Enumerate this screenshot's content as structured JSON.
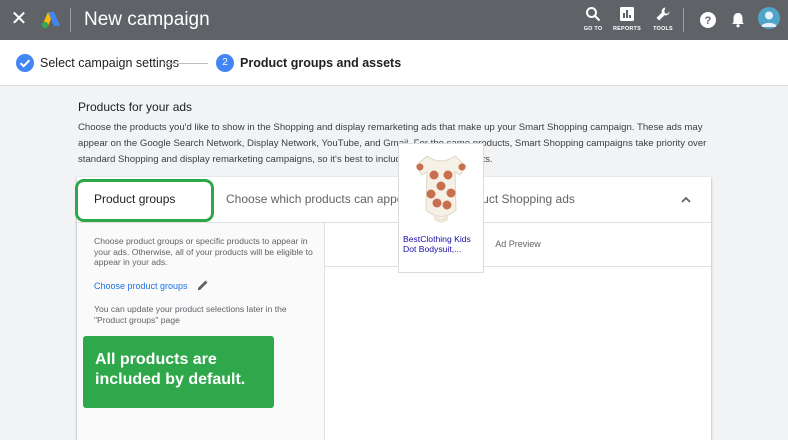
{
  "topbar": {
    "title": "New campaign",
    "tools": [
      {
        "label": "GO TO",
        "icon": "search-icon"
      },
      {
        "label": "REPORTS",
        "icon": "reports-icon"
      },
      {
        "label": "TOOLS",
        "icon": "wrench-icon"
      }
    ],
    "bg_color": "#5f6368"
  },
  "stepper": {
    "step1_label": "Select campaign settings",
    "step2_number": "2",
    "step2_label": "Product groups and assets"
  },
  "section": {
    "title": "Products for your ads",
    "description": "Choose the products you'd like to show in the Shopping and display remarketing ads that make up your Smart Shopping campaign. These ads may appear on the Google Search Network, Display Network, YouTube, and Gmail. For the same products, Smart Shopping campaigns take priority over standard Shopping and display remarketing campaigns, so it's best to include all of your products."
  },
  "card": {
    "header_label": "Product groups",
    "header_subtitle": "Choose which products can appear in your Product Shopping ads",
    "left_text": "Choose product groups or specific products to appear in your ads. Otherwise, all of your products will be eligible to appear in your ads.",
    "link_label": "Choose product groups",
    "left_note": "You can update your product selections later in the \"Product groups\" page",
    "ad_preview_label": "Ad Preview",
    "product_name": "BestClothing Kids Dot Bodysuit,..."
  },
  "annotation": {
    "callout_text": "All products are included by default.",
    "accent_color": "#2ea84a"
  }
}
